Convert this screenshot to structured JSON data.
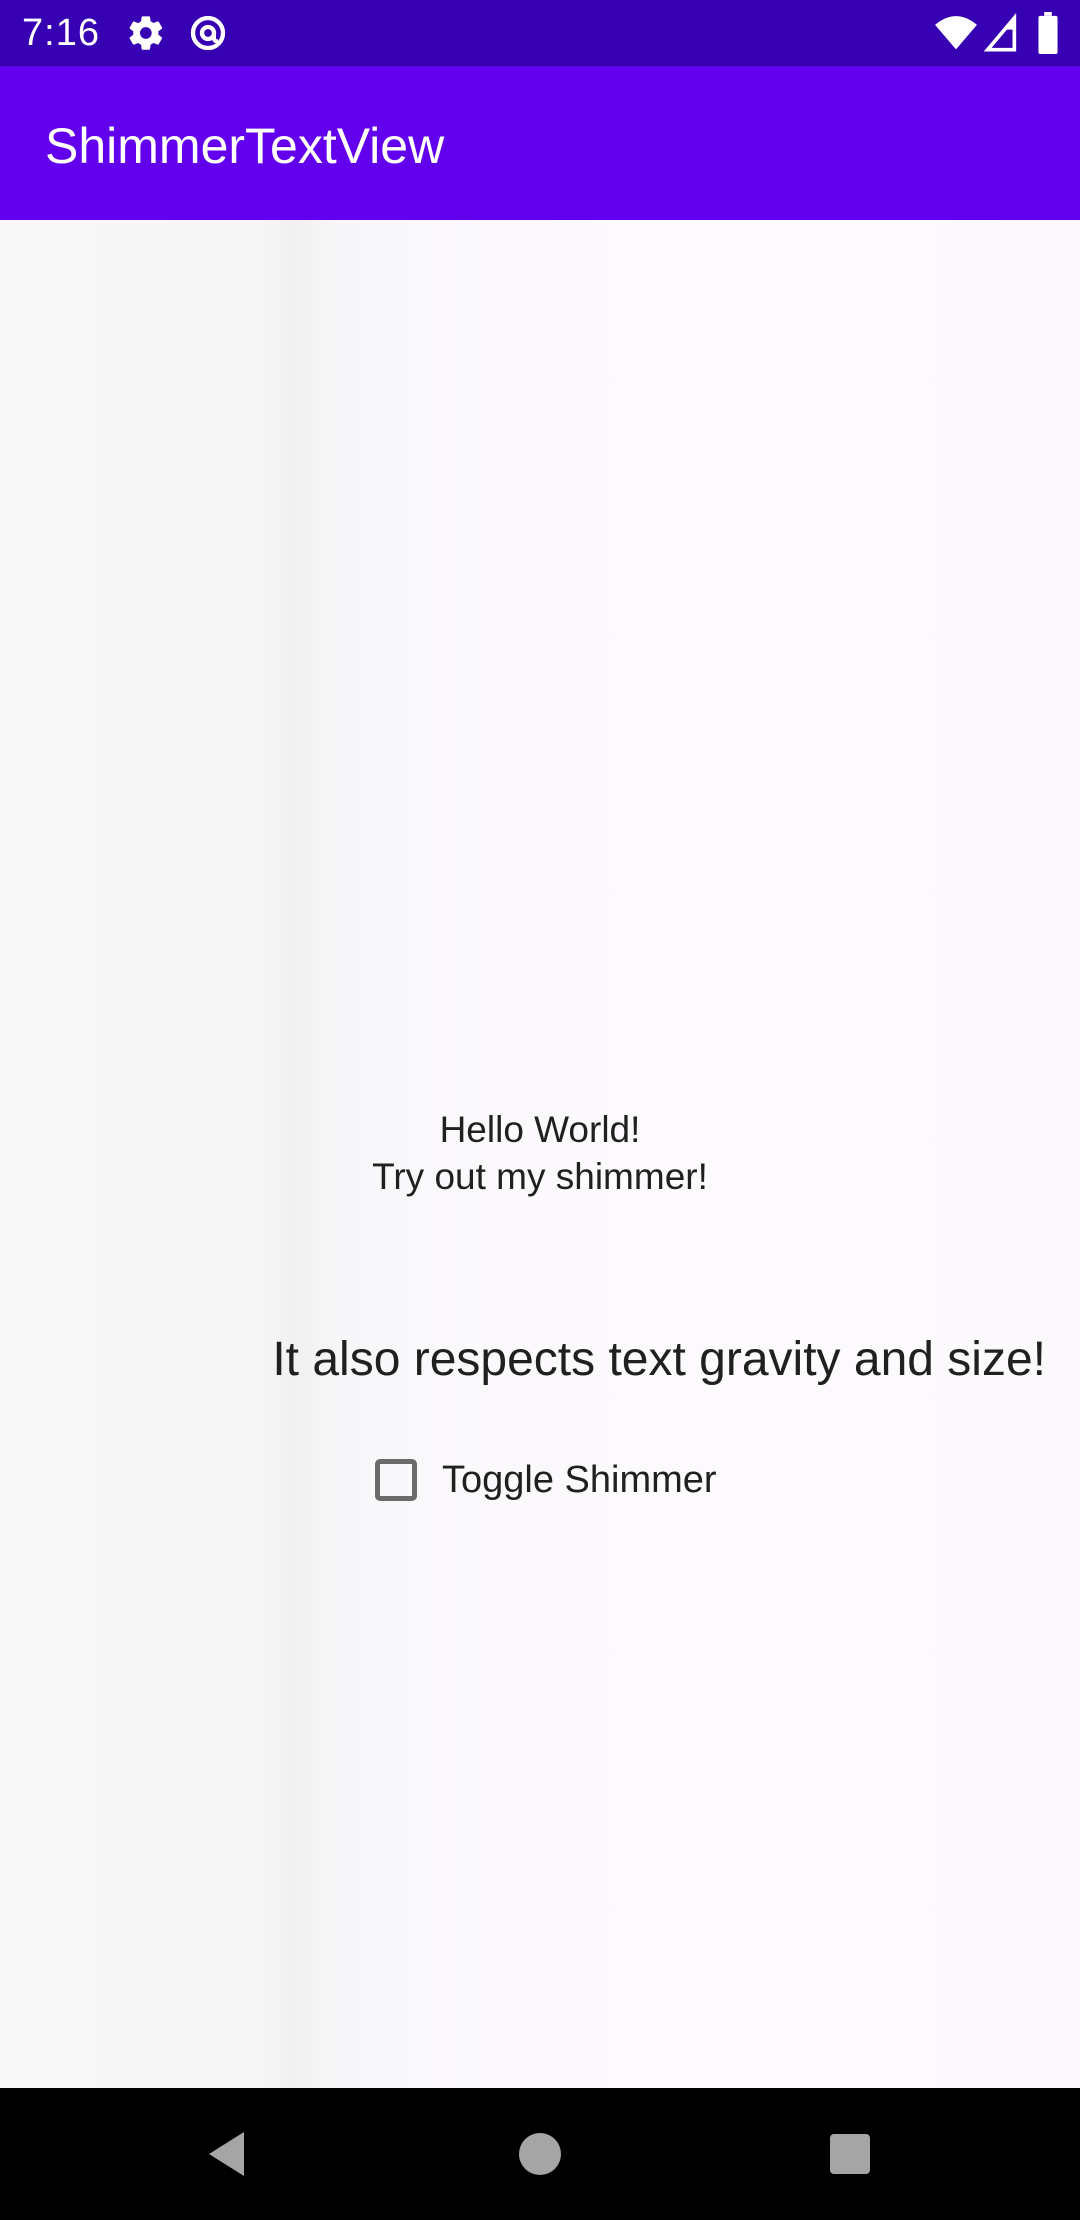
{
  "status_bar": {
    "time": "7:16",
    "icons": [
      "gear-icon",
      "at-sign-icon",
      "wifi-icon",
      "signal-icon",
      "battery-icon"
    ],
    "background": "#3700b3"
  },
  "app_bar": {
    "title": "ShimmerTextView",
    "background": "#6200ee"
  },
  "main": {
    "hello_line1": "Hello World!",
    "hello_line2": "Try out my shimmer!",
    "gravity_text": "It also respects text gravity and size!",
    "toggle": {
      "label": "Toggle Shimmer",
      "checked": false
    }
  },
  "nav_bar": {
    "buttons": [
      "back-icon",
      "home-icon",
      "recents-icon"
    ]
  }
}
